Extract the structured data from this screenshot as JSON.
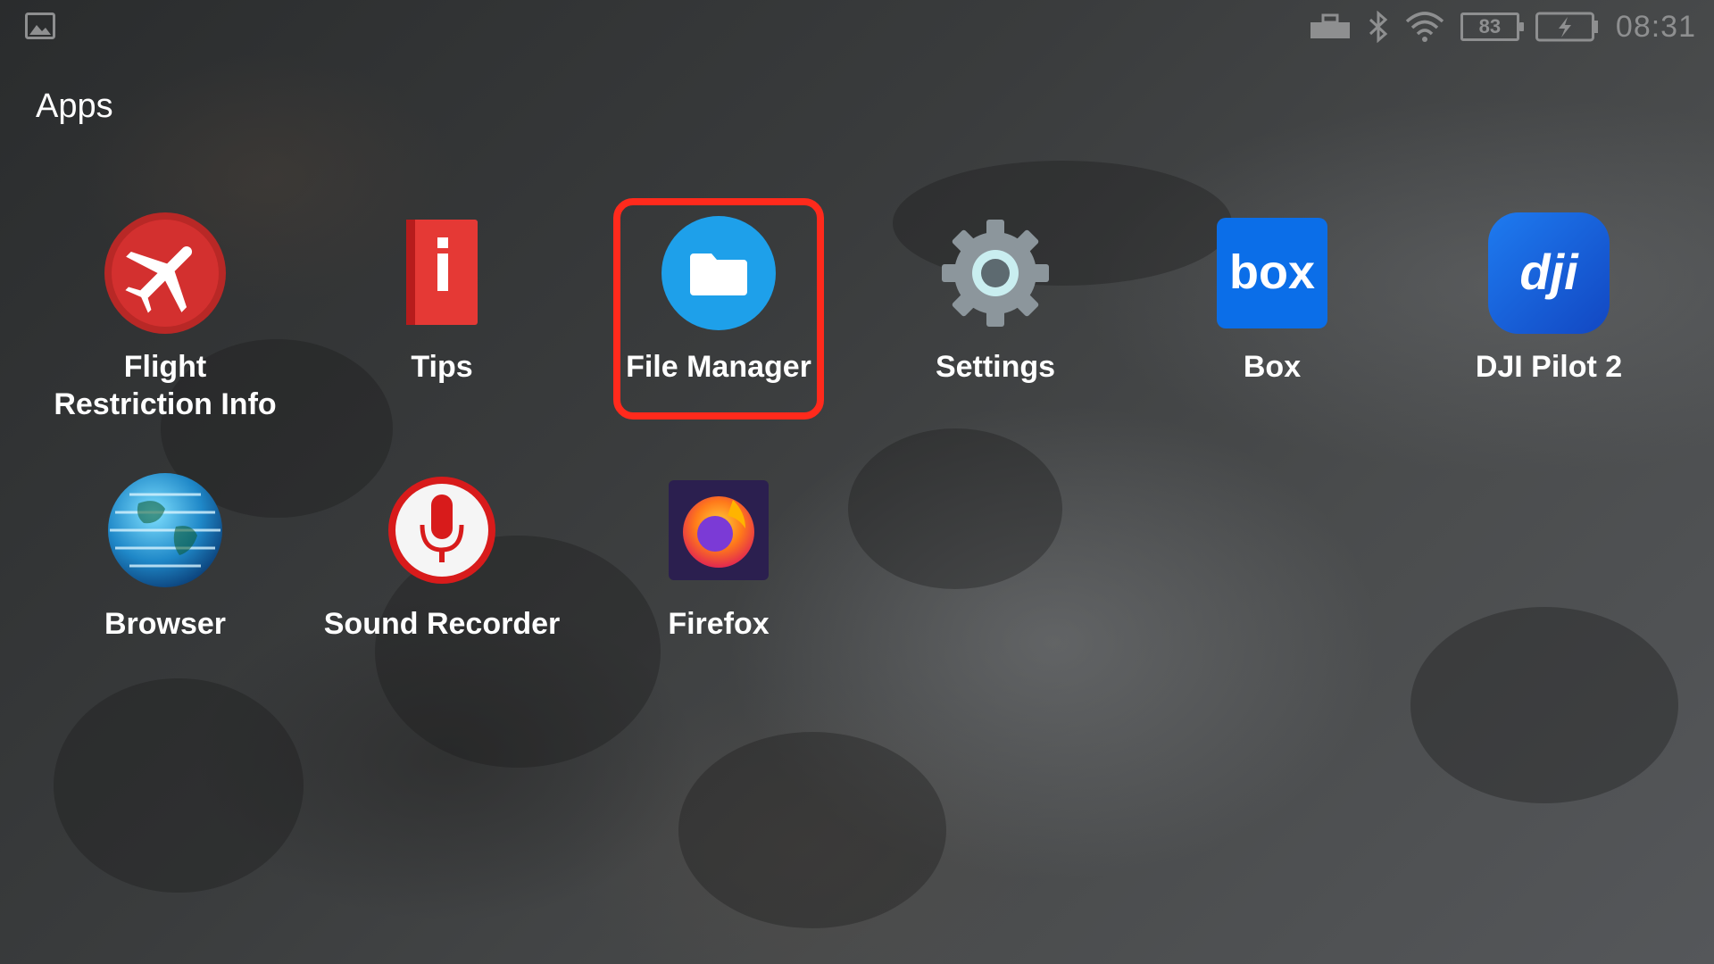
{
  "status_bar": {
    "left_icon": "image-icon",
    "icons": [
      "usb-icon",
      "bluetooth-icon",
      "wifi-icon"
    ],
    "battery_level": "83",
    "second_battery_icon": "battery-charging-icon",
    "clock": "08:31",
    "icon_color": "#8e8f90"
  },
  "page": {
    "title": "Apps"
  },
  "apps": [
    {
      "id": "flight-restriction-info",
      "label_line1": "Flight",
      "label_line2": "Restriction Info",
      "icon": "airplane-icon",
      "color": "#d3302f"
    },
    {
      "id": "tips",
      "label_line1": "Tips",
      "icon": "info-book-icon",
      "color": "#e53935"
    },
    {
      "id": "file-manager",
      "label_line1": "File Manager",
      "icon": "folder-icon",
      "color": "#1ea0ea"
    },
    {
      "id": "settings",
      "label_line1": "Settings",
      "icon": "gear-icon",
      "color": "#8c969c"
    },
    {
      "id": "box",
      "label_line1": "Box",
      "icon": "box-logo-icon",
      "logo_text": "box",
      "color": "#0b6ee8"
    },
    {
      "id": "dji-pilot-2",
      "label_line1": "DJI Pilot 2",
      "icon": "dji-logo-icon",
      "logo_text": "dji",
      "color": "#1b6de8"
    },
    {
      "id": "browser",
      "label_line1": "Browser",
      "icon": "globe-icon",
      "color": "#1f88c8"
    },
    {
      "id": "sound-recorder",
      "label_line1": "Sound Recorder",
      "icon": "microphone-icon",
      "color": "#d81b1b"
    },
    {
      "id": "firefox",
      "label_line1": "Firefox",
      "icon": "firefox-icon",
      "color": "#2b1f4f"
    }
  ],
  "highlight": {
    "target": "file-manager",
    "color": "#ff2a1c"
  }
}
